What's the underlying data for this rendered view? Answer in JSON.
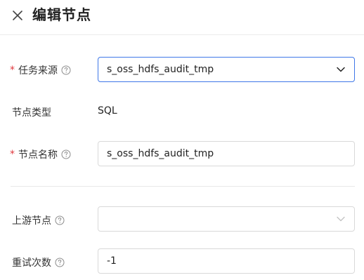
{
  "header": {
    "title": "编辑节点"
  },
  "form": {
    "task_source": {
      "label": "任务来源",
      "required": "*",
      "value": "s_oss_hdfs_audit_tmp"
    },
    "node_type": {
      "label": "节点类型",
      "value": "SQL"
    },
    "node_name": {
      "label": "节点名称",
      "required": "*",
      "value": "s_oss_hdfs_audit_tmp"
    },
    "upstream_node": {
      "label": "上游节点",
      "value": ""
    },
    "retry_count": {
      "label": "重试次数",
      "value": "-1"
    }
  },
  "colors": {
    "accent": "#3f77e8",
    "required": "#e0393e",
    "border": "#d9d9d9"
  },
  "icons": {
    "close": "close-icon",
    "help": "question-circle-icon",
    "dropdown": "chevron-down-icon"
  }
}
